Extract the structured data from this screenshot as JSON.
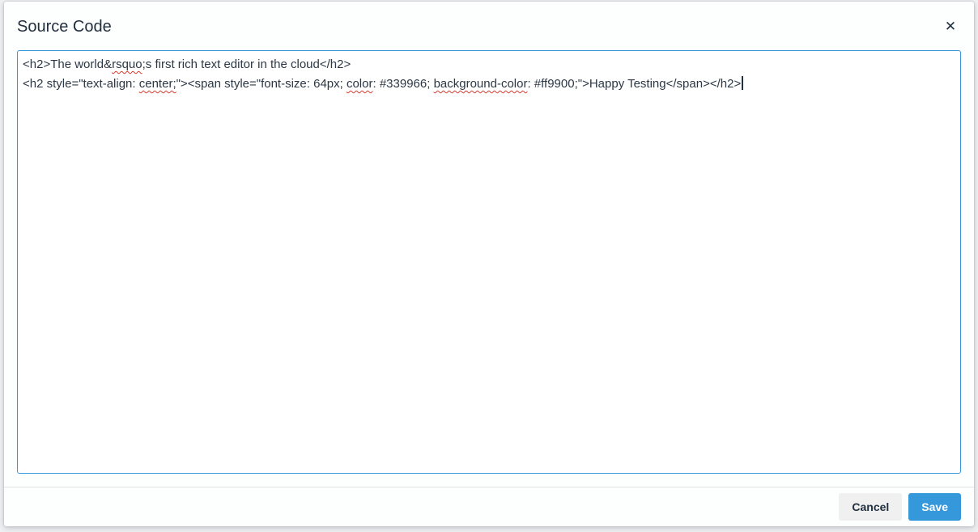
{
  "dialog": {
    "title": "Source Code",
    "close_icon": "✕"
  },
  "editor": {
    "value": "<h2>The world&rsquo;s first rich text editor in the cloud</h2>\n<h2 style=\"text-align: center;\"><span style=\"font-size: 64px; color: #339966; background-color: #ff9900;\">Happy Testing</span></h2>",
    "placeholder": "",
    "lines": [
      {
        "segments": [
          {
            "text": "<h2>The world&"
          },
          {
            "text": "rsquo",
            "misspelled": true
          },
          {
            "text": ";s first rich text editor in the cloud</h2>"
          }
        ]
      },
      {
        "caret_at_end": true,
        "segments": [
          {
            "text": "<h2 style=\"text-align: "
          },
          {
            "text": "center;",
            "misspelled": true
          },
          {
            "text": "\"><span style=\"font-size: 64px; "
          },
          {
            "text": "color",
            "misspelled": true
          },
          {
            "text": ": #339966; "
          },
          {
            "text": "background-color",
            "misspelled": true
          },
          {
            "text": ": #ff9900;\">Happy Testing</span></h2>"
          }
        ]
      }
    ]
  },
  "footer": {
    "cancel_label": "Cancel",
    "save_label": "Save"
  },
  "colors": {
    "accent_blue": "#3498db",
    "title_text": "#222f3e",
    "code_text": "#2c3845",
    "spellcheck_red": "#d83a2e",
    "footer_divider": "#e0e4e6",
    "cancel_bg": "#f0f0f0",
    "page_background": "#eff1f2"
  }
}
